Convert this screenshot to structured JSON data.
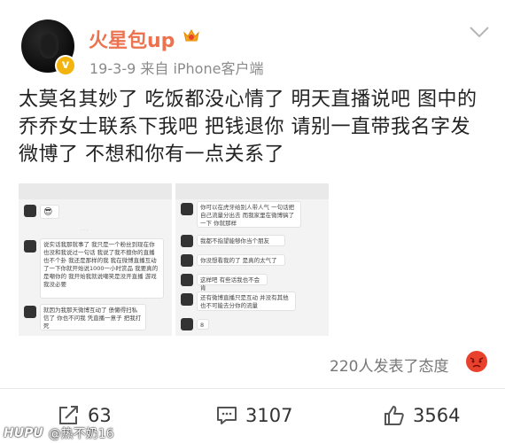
{
  "post": {
    "username": "火星包up",
    "meta": "19-3-9   来自 iPhone客户端",
    "content": "太莫名其妙了 吃饭都没心情了 明天直播说吧 图中的乔乔女士联系下我吧 把钱退你 请别一直带我名字发微博了 不想和你有一点关系了",
    "reactions_text": "220人发表了态度"
  },
  "screenshots": {
    "left": {
      "messages": [
        "说实话我那就事了 我只是一个粉丝到现在你也没和我说过一句话 我说了我不擅你的直播 也不个卦 我还是那样的我 我在微博直播互动了一下你就开始说1000一小时赏品 我要真的是嘲你的 我开始我就说嘲笑是没开直播 游戏 我没必要",
        "就因为我那天微博互动了 债懒得扫私信了 你也不问我 凭直播一意子 把我打死"
      ],
      "emoji": "😎"
    },
    "right": {
      "messages": [
        "你可以在虎牙给别人带人气 一句话把自己流量分出去 而我家里在微博搞了一下 你就那样",
        "我都不指望能够你当个朋友",
        "你没想看我的了 是真的太气了",
        "这样吧 有些话我也不会肯",
        "还有微博直播只是互动 并没有其他 也不可能去分你的流量",
        "8"
      ]
    }
  },
  "actions": {
    "repost_count": "63",
    "comment_count": "3107",
    "like_count": "3564"
  },
  "watermark": {
    "brand": "HUPU",
    "user": "@热不奶16"
  },
  "colors": {
    "username": "#eb7350",
    "meta": "#8b8b8b",
    "verified": "#f3b410",
    "angry": "#e8412c"
  }
}
